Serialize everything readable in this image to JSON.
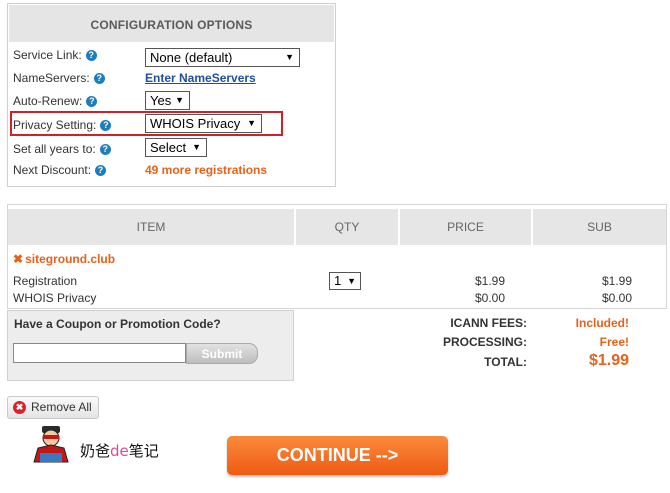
{
  "config": {
    "title": "CONFIGURATION OPTIONS",
    "help_glyph": "?",
    "service_link": {
      "label": "Service Link:",
      "value": "None (default)"
    },
    "nameservers": {
      "label": "NameServers:",
      "link": "Enter NameServers"
    },
    "auto_renew": {
      "label": "Auto-Renew:",
      "value": "Yes"
    },
    "privacy": {
      "label": "Privacy Setting:",
      "value": "WHOIS Privacy"
    },
    "all_years": {
      "label": "Set all years to:",
      "value": "Select"
    },
    "next_discount": {
      "label": "Next Discount:",
      "value": "49 more registrations"
    }
  },
  "cart": {
    "headers": {
      "item": "ITEM",
      "qty": "QTY",
      "price": "PRICE",
      "sub": "SUB"
    },
    "domain": "siteground.club",
    "remove_glyph": "✖",
    "rows": [
      {
        "label": "Registration",
        "price": "$1.99",
        "sub": "$1.99"
      },
      {
        "label": "WHOIS Privacy",
        "price": "$0.00",
        "sub": "$0.00"
      }
    ],
    "qty": "1"
  },
  "coupon": {
    "title": "Have a Coupon or Promotion Code?",
    "input_value": "",
    "submit_label": "Submit"
  },
  "totals": {
    "icann_label": "ICANN FEES:",
    "icann_value": "Included!",
    "processing_label": "PROCESSING:",
    "processing_value": "Free!",
    "total_label": "TOTAL:",
    "total_value": "$1.99"
  },
  "actions": {
    "remove_all_label": "Remove All",
    "remove_glyph": "✖",
    "continue_label": "CONTINUE -->"
  },
  "watermark": {
    "text_a": "奶爸",
    "text_b": "de",
    "text_c": "笔记"
  },
  "colors": {
    "accent_orange": "#e8611a",
    "link_blue": "#1f4fa3",
    "help_blue": "#1a7fc1",
    "highlight_red": "#d0202a"
  },
  "glyphs": {
    "select_arrow": "▼"
  }
}
